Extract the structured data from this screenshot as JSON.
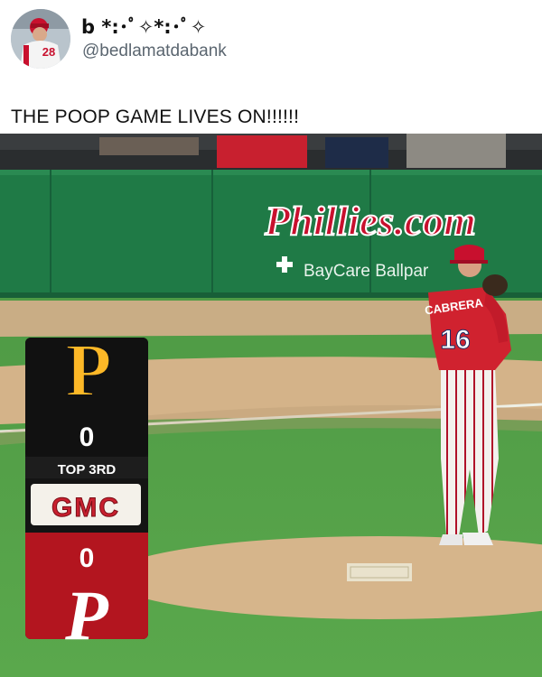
{
  "tweet": {
    "display_name": "b *:･ﾟ✧*:･ﾟ✧",
    "handle": "@bedlamatdabank",
    "text": "THE POOP GAME LIVES ON!!!!!!",
    "avatar_jersey_number": "28"
  },
  "photo": {
    "wall_sign": "Phillies.com",
    "wall_sponsor": "BayCare Ballpar",
    "player_name": "CABRERA",
    "player_number": "16",
    "scorebug": {
      "away_logo_letter": "P",
      "away_score": "0",
      "inning": "TOP 3RD",
      "sponsor": "GMC",
      "home_score": "0",
      "home_logo_letter": "P"
    }
  },
  "colors": {
    "wall_green": "#1f7a46",
    "phillies_red": "#c8102e",
    "pirates_gold": "#fdb827",
    "grass_green": "#55a04a"
  }
}
